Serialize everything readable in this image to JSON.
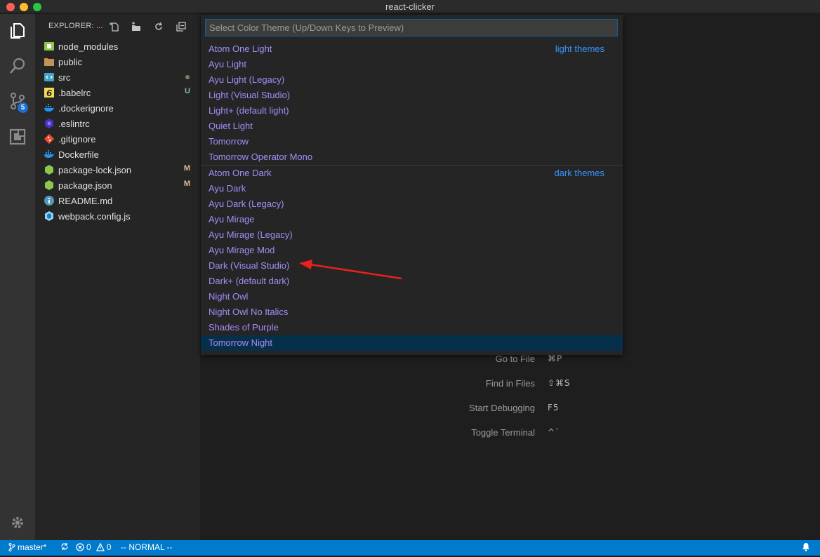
{
  "window": {
    "title": "react-clicker"
  },
  "sidebar": {
    "header": "EXPLORER: ...",
    "files": [
      {
        "name": "node_modules",
        "icon": "node-folder-icon",
        "status": ""
      },
      {
        "name": "public",
        "icon": "folder-icon",
        "status": ""
      },
      {
        "name": "src",
        "icon": "src-folder-icon",
        "status": "dot"
      },
      {
        "name": ".babelrc",
        "icon": "babel-icon",
        "status": "U"
      },
      {
        "name": ".dockerignore",
        "icon": "docker-icon",
        "status": ""
      },
      {
        "name": ".eslintrc",
        "icon": "eslint-icon",
        "status": ""
      },
      {
        "name": ".gitignore",
        "icon": "git-icon",
        "status": ""
      },
      {
        "name": "Dockerfile",
        "icon": "docker-icon",
        "status": ""
      },
      {
        "name": "package-lock.json",
        "icon": "npm-icon",
        "status": "M"
      },
      {
        "name": "package.json",
        "icon": "npm-icon",
        "status": "M"
      },
      {
        "name": "README.md",
        "icon": "info-icon",
        "status": ""
      },
      {
        "name": "webpack.config.js",
        "icon": "webpack-icon",
        "status": ""
      }
    ]
  },
  "activity": {
    "source_control_badge": "5"
  },
  "quickpick": {
    "placeholder": "Select Color Theme (Up/Down Keys to Preview)",
    "light_group_label": "light themes",
    "dark_group_label": "dark themes",
    "light_themes": [
      "Atom One Light",
      "Ayu Light",
      "Ayu Light (Legacy)",
      "Light (Visual Studio)",
      "Light+ (default light)",
      "Quiet Light",
      "Tomorrow",
      "Tomorrow Operator Mono"
    ],
    "dark_themes": [
      "Atom One Dark",
      "Ayu Dark",
      "Ayu Dark (Legacy)",
      "Ayu Mirage",
      "Ayu Mirage (Legacy)",
      "Ayu Mirage Mod",
      "Dark (Visual Studio)",
      "Dark+ (default dark)",
      "Night Owl",
      "Night Owl No Italics",
      "Shades of Purple",
      "Tomorrow Night"
    ],
    "selected": "Tomorrow Night"
  },
  "shortcuts": [
    {
      "label": "Go to File",
      "keys": "⌘P"
    },
    {
      "label": "Find in Files",
      "keys": "⇧⌘S"
    },
    {
      "label": "Start Debugging",
      "keys": "F5"
    },
    {
      "label": "Toggle Terminal",
      "keys": "^`"
    }
  ],
  "statusbar": {
    "branch": "master*",
    "errors": "0",
    "warnings": "0",
    "mode": "-- NORMAL --"
  },
  "colors": {
    "accent": "#007acc",
    "theme_text": "#a68cf5",
    "group_label": "#3794ff"
  }
}
